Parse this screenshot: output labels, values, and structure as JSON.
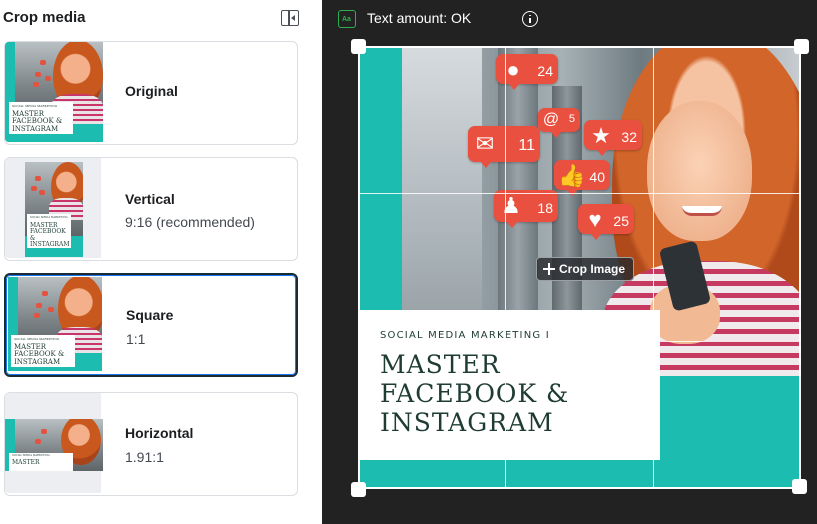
{
  "panel": {
    "title": "Crop media",
    "collapse_icon": "sidebar-collapse-icon"
  },
  "options": [
    {
      "label": "Original",
      "sub": ""
    },
    {
      "label": "Vertical",
      "sub": "9:16 (recommended)"
    },
    {
      "label": "Square",
      "sub": "1:1",
      "selected": true
    },
    {
      "label": "Horizontal",
      "sub": "1.91:1"
    }
  ],
  "preview": {
    "text_amount": "Text amount: OK",
    "text_icon": "text-overlay-icon",
    "info_icon": "info-icon",
    "crop_label": "Crop Image",
    "ad": {
      "tagline": "SOCIAL MEDIA MARKETING I",
      "line1": "MASTER",
      "line2": "FACEBOOK &",
      "line3": "INSTAGRAM"
    },
    "bubbles": [
      {
        "icon": "comment-icon",
        "count": "24"
      },
      {
        "icon": "at-icon",
        "count": "5"
      },
      {
        "icon": "star-icon",
        "count": "32"
      },
      {
        "icon": "mail-icon",
        "count": "11"
      },
      {
        "icon": "like-icon",
        "count": "40"
      },
      {
        "icon": "user-icon",
        "count": "18"
      },
      {
        "icon": "heart-icon",
        "count": "25"
      }
    ]
  },
  "colors": {
    "teal": "#1cbcb1",
    "accent_red": "#e9503f",
    "selected_border": "#1c2b33",
    "dark_bg": "#222223",
    "ok_green": "#2fae4f"
  }
}
